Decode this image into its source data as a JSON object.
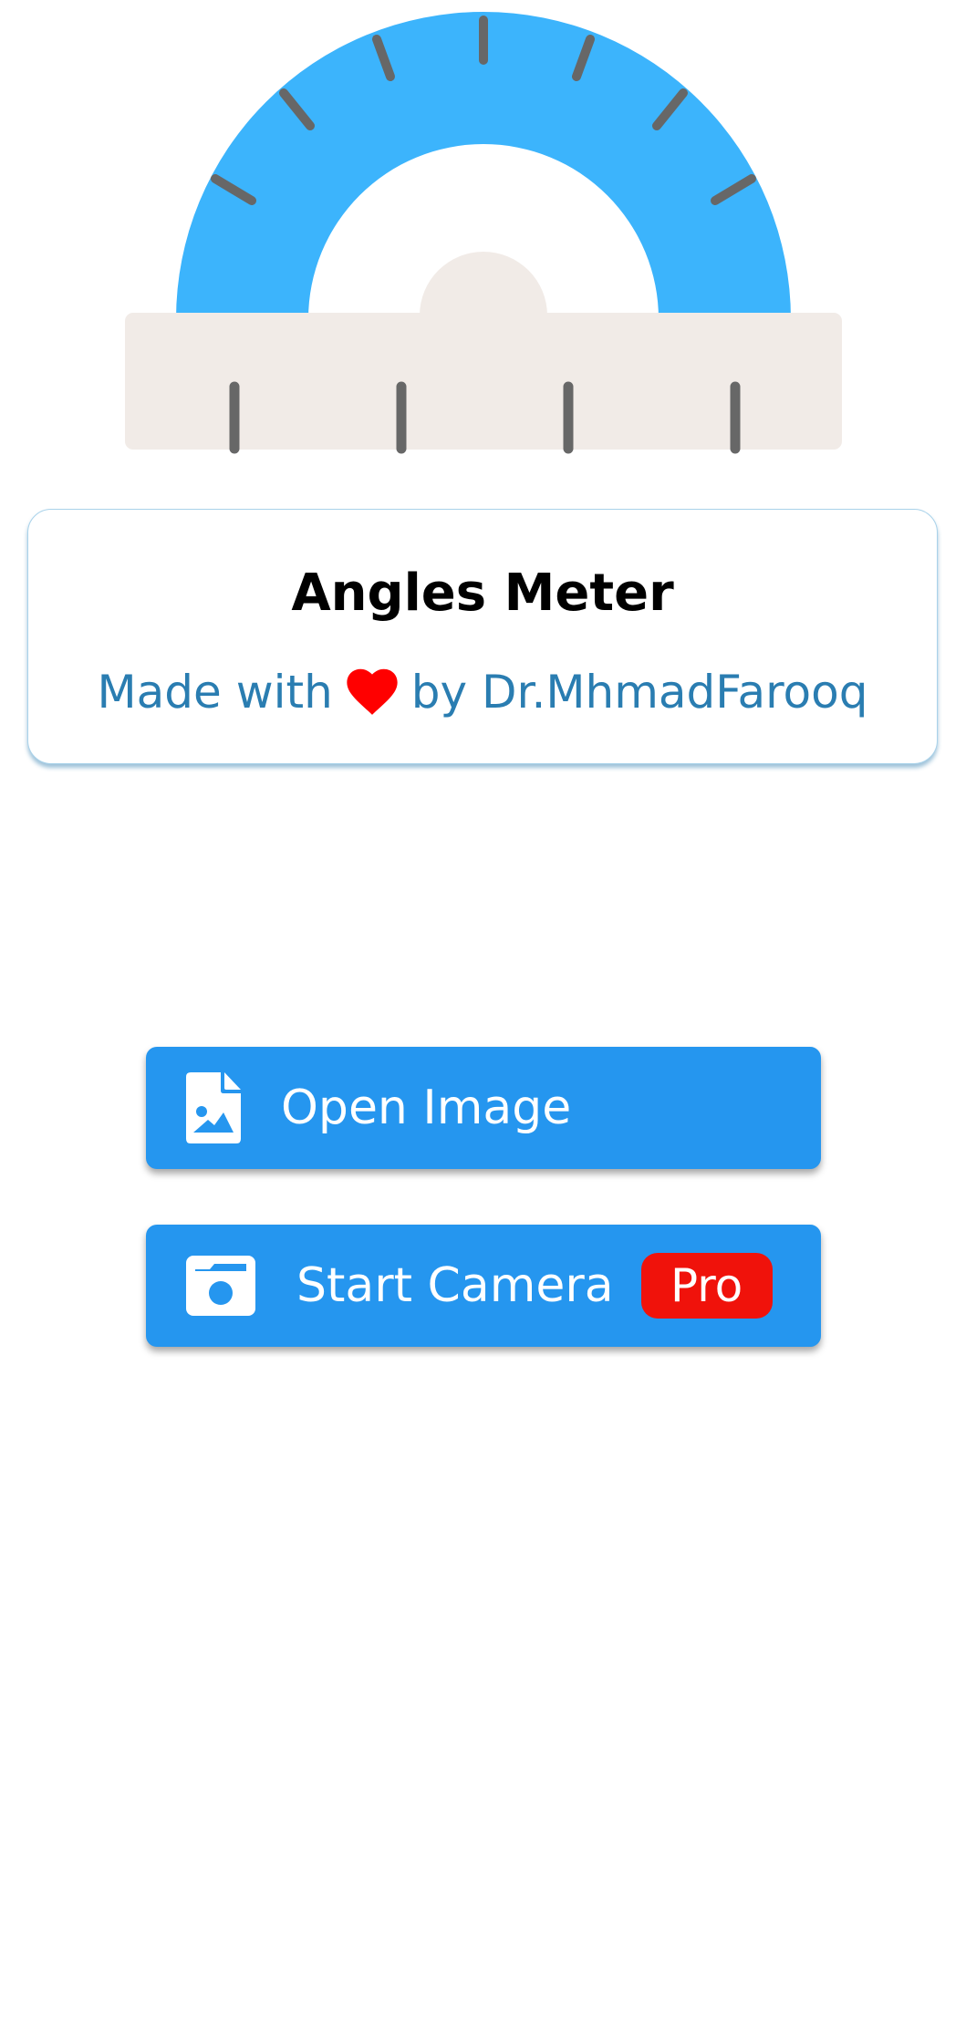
{
  "app": {
    "title": "Angles Meter",
    "credit_prefix": "Made with",
    "credit_suffix": "by Dr.MhmadFarooq"
  },
  "logo": {
    "icon": "protractor-icon",
    "colors": {
      "arc": "#3cb4fc",
      "ruler": "#f1ebe7",
      "ticks": "#676767"
    }
  },
  "icons": {
    "heart": "heart-icon",
    "open_image": "image-file-icon",
    "camera": "camera-icon"
  },
  "buttons": {
    "open_image_label": "Open Image",
    "start_camera_label": "Start Camera",
    "pro_badge": "Pro"
  },
  "colors": {
    "button": "#2596ef",
    "credit_text": "#2a7db1",
    "heart": "#ff0000",
    "pro_badge": "#f0120b",
    "card_border": "#a9d2ea"
  }
}
